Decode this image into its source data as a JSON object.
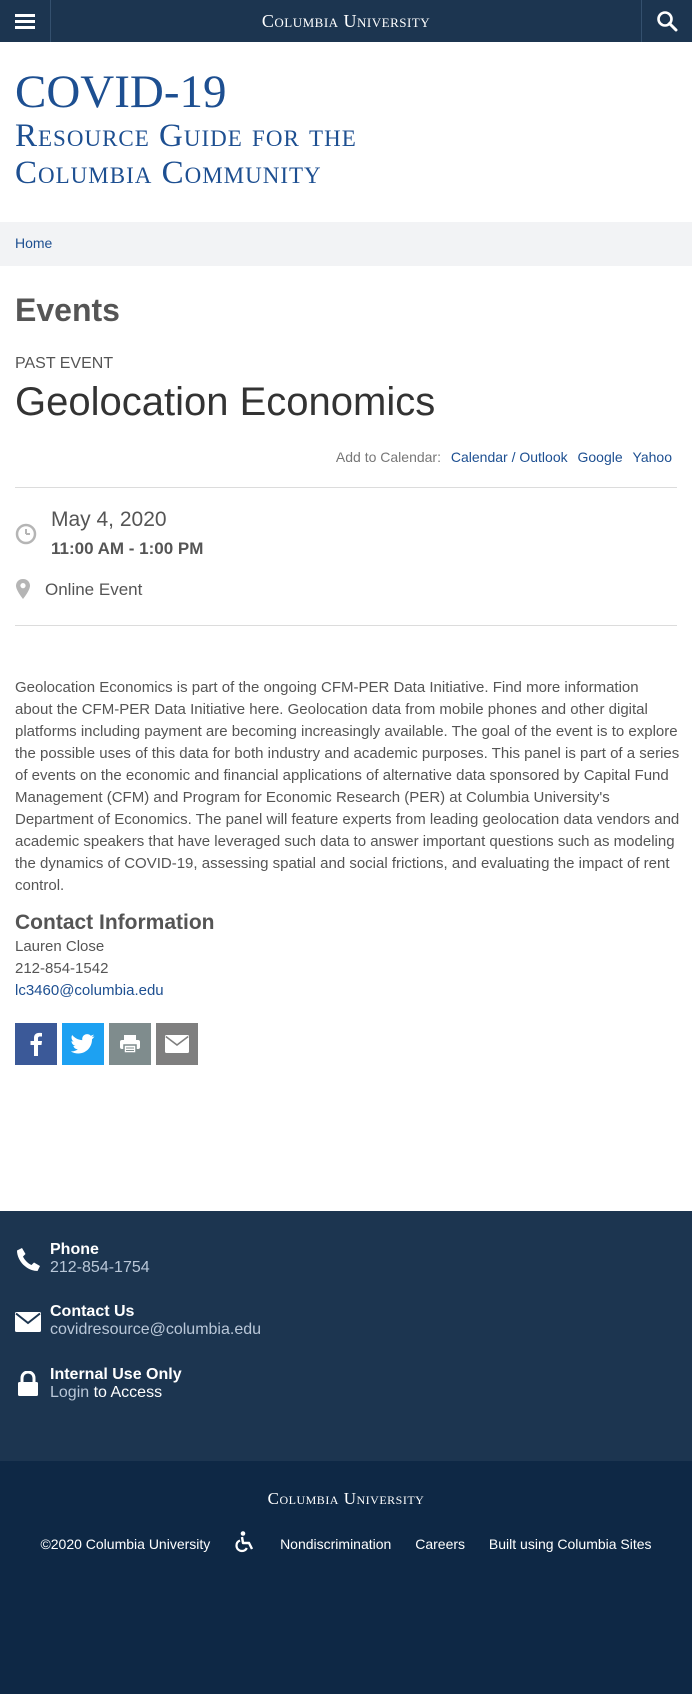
{
  "header": {
    "brand": "Columbia University",
    "menu_icon": "hamburger-icon",
    "search_icon": "search-icon"
  },
  "site": {
    "title_line1": "COVID-19",
    "title_line2": "Resource Guide for the",
    "title_line3": "Columbia Community"
  },
  "breadcrumb": {
    "home": "Home"
  },
  "page": {
    "section": "Events",
    "label": "PAST EVENT",
    "title": "Geolocation Economics"
  },
  "calendar": {
    "label": "Add to Calendar:",
    "links": [
      "Calendar / Outlook",
      "Google",
      "Yahoo"
    ]
  },
  "event": {
    "date": "May 4, 2020",
    "time": "11:00 AM - 1:00 PM",
    "location": "Online Event"
  },
  "description": "Geolocation Economics is part of the ongoing CFM-PER Data Initiative. Find more information about the CFM-PER Data Initiative here. Geolocation data from mobile phones and other digital platforms including payment are becoming increasingly available. The goal of the event is to explore the possible uses of this data for both industry and academic purposes. This panel is part of a series of events on the economic and financial applications of alternative data sponsored by Capital Fund Management (CFM) and Program for Economic Research (PER) at Columbia University's Department of Economics. The panel will feature experts from leading geolocation data vendors and academic speakers that have leveraged such data to answer important questions such as modeling the dynamics of COVID-19, assessing spatial and social frictions, and evaluating the impact of rent control.",
  "contact": {
    "heading": "Contact Information",
    "name": "Lauren Close",
    "phone": "212-854-1542",
    "email": "lc3460@columbia.edu"
  },
  "share": {
    "icons": [
      "facebook-icon",
      "twitter-icon",
      "print-icon",
      "email-icon"
    ],
    "colors": [
      "#3b5998",
      "#1da1f2",
      "#7f8c8d",
      "#7f7f7f"
    ]
  },
  "footer": {
    "phone_title": "Phone",
    "phone_value": "212-854-1754",
    "contact_title": "Contact Us",
    "contact_value": "covidresource@columbia.edu",
    "internal_title": "Internal Use Only",
    "login_link": "Login",
    "login_suffix": " to Access"
  },
  "bottom_footer": {
    "brand": "Columbia University",
    "copyright": "©2020 Columbia University",
    "accessibility_icon": "accessibility-icon",
    "links": [
      "Nondiscrimination",
      "Careers",
      "Built using Columbia Sites"
    ]
  },
  "colors": {
    "navy": "#1c3550",
    "navy_dark": "#0e2845",
    "link_blue": "#1d4f91",
    "breadcrumb_bg": "#f2f3f5"
  }
}
